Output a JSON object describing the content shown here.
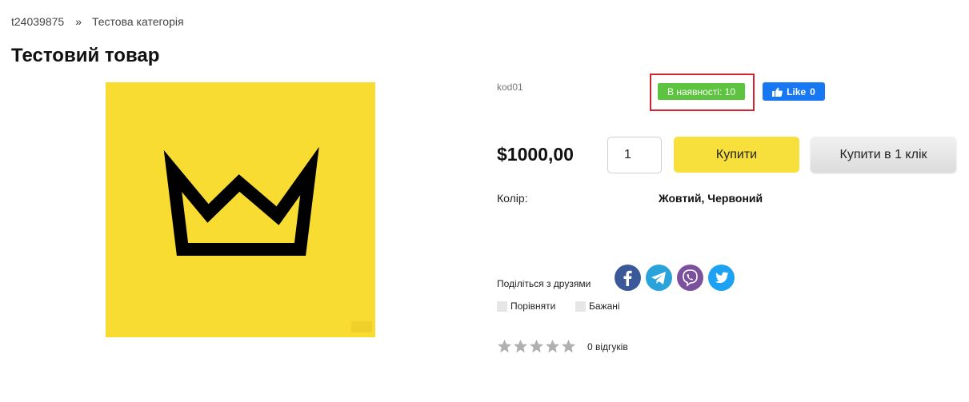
{
  "breadcrumb": {
    "home": "t24039875",
    "separator": "»",
    "category": "Тестова категорія"
  },
  "product": {
    "title": "Тестовий товар",
    "sku": "kod01",
    "stock_badge": "В наявності: 10",
    "price": "$1000,00",
    "quantity": "1",
    "image_bg_color": "#f8dc32"
  },
  "facebook": {
    "like_label": "Like",
    "like_count": "0",
    "color": "#1877f2"
  },
  "buttons": {
    "buy": "Купити",
    "buy_one_click": "Купити в 1 клік"
  },
  "attributes": {
    "color_label": "Колір:",
    "color_value": "Жовтий, Червоний"
  },
  "share": {
    "label": "Поділіться з друзями",
    "networks": [
      "facebook-icon",
      "telegram-icon",
      "viber-icon",
      "twitter-icon"
    ]
  },
  "actions": {
    "compare": "Порівняти",
    "wishlist": "Бажані"
  },
  "rating": {
    "stars_filled": 0,
    "stars_total": 5,
    "reviews": "0 відгуків"
  }
}
